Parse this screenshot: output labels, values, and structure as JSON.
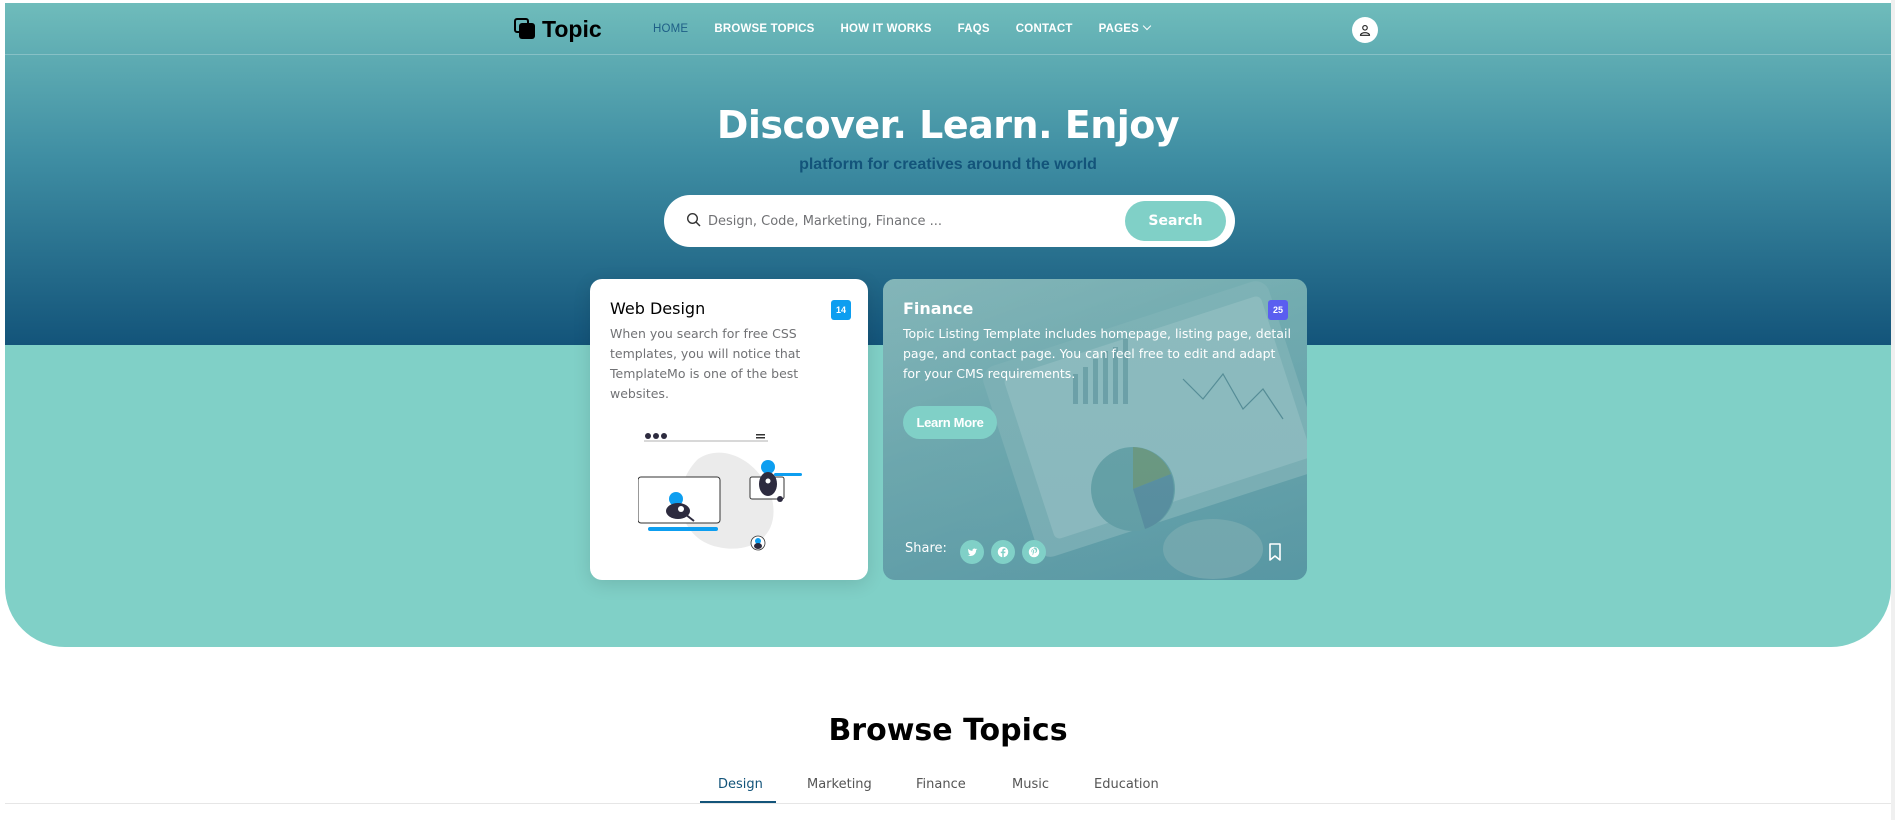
{
  "nav": {
    "brand": "Topic",
    "items": [
      {
        "label": "HOME",
        "active": true
      },
      {
        "label": "BROWSE TOPICS"
      },
      {
        "label": "HOW IT WORKS"
      },
      {
        "label": "FAQS"
      },
      {
        "label": "CONTACT"
      },
      {
        "label": "PAGES"
      }
    ]
  },
  "hero": {
    "title": "Discover. Learn. Enjoy",
    "subtitle": "platform for creatives around the world",
    "search_placeholder": "Design, Code, Marketing, Finance ...",
    "search_button": "Search"
  },
  "cards": {
    "web_design": {
      "title": "Web Design",
      "badge": "14",
      "text": "When you search for free CSS templates, you will notice that TemplateMo is one of the best websites."
    },
    "finance": {
      "title": "Finance",
      "badge": "25",
      "text": "Topic Listing Template includes homepage, listing page, detail page, and contact page. You can feel free to edit and adapt for your CMS requirements.",
      "button": "Learn More",
      "share_label": "Share:"
    }
  },
  "browse": {
    "title": "Browse Topics",
    "tabs": [
      "Design",
      "Marketing",
      "Finance",
      "Music",
      "Education"
    ]
  },
  "colors": {
    "accent": "#80d0c7",
    "primary_dark": "#13547a",
    "badge_blue": "#0d9ef0",
    "badge_purple": "#5a5ef0"
  },
  "icons": [
    "user-icon",
    "search-icon",
    "twitter-icon",
    "facebook-icon",
    "pinterest-icon",
    "bookmark-icon",
    "chevron-down-icon"
  ]
}
